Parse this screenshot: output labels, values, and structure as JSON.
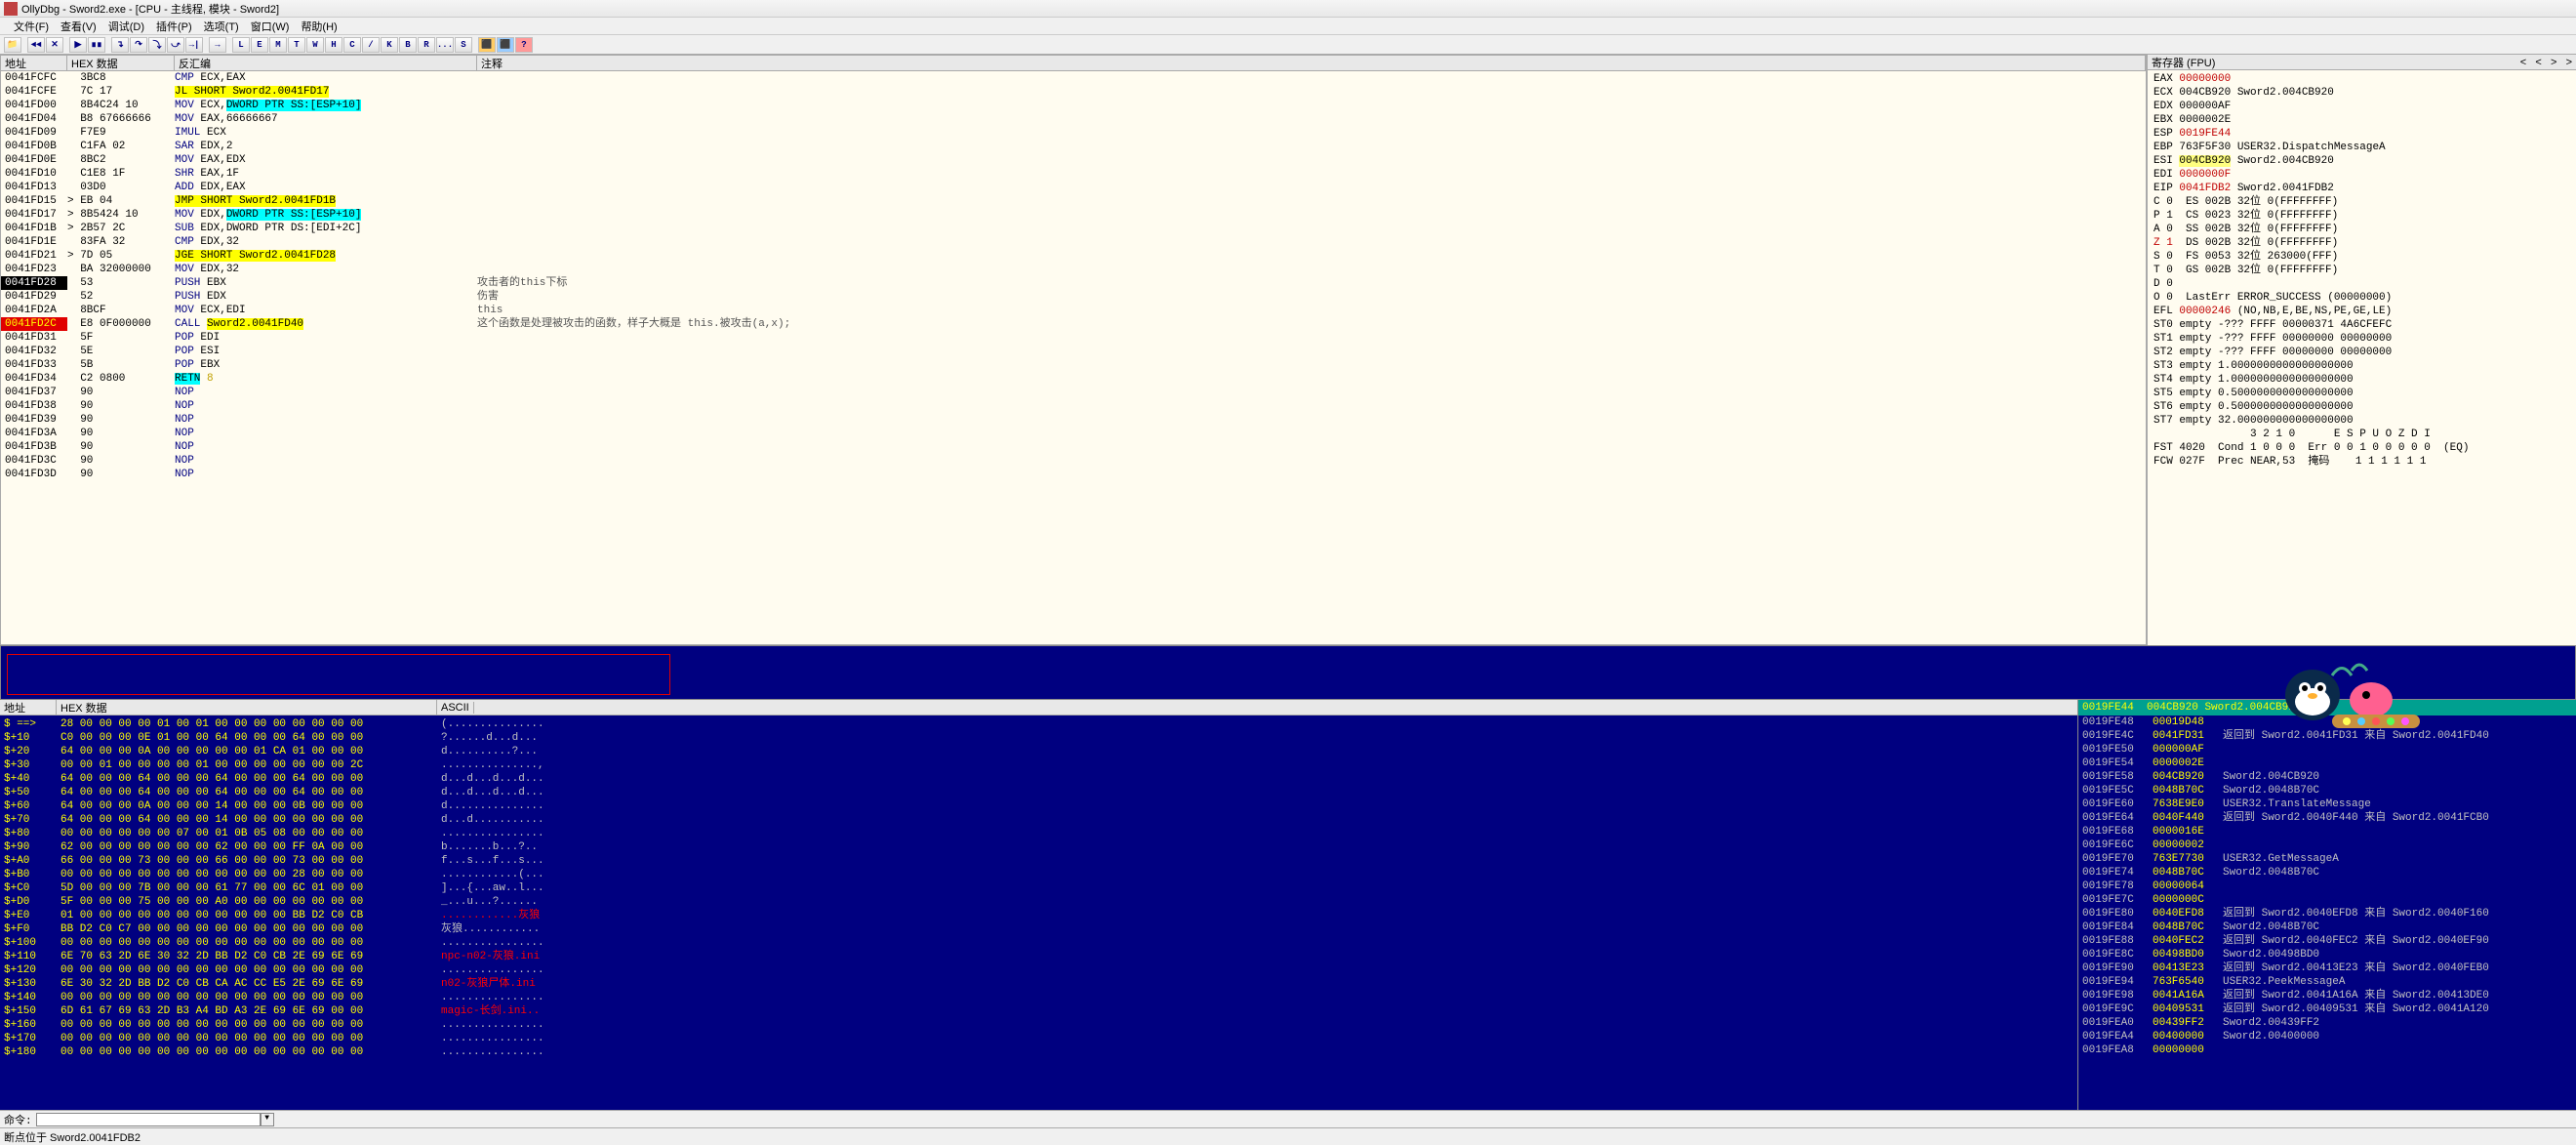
{
  "title": "OllyDbg - Sword2.exe - [CPU - 主线程, 模块 - Sword2]",
  "menu": [
    "文件(F)",
    "查看(V)",
    "调试(D)",
    "插件(P)",
    "选项(T)",
    "窗口(W)",
    "帮助(H)"
  ],
  "toolbar_letters": [
    "L",
    "E",
    "M",
    "T",
    "W",
    "H",
    "C",
    "/",
    "K",
    "B",
    "R",
    "...",
    "S"
  ],
  "disasm_headers": {
    "addr": "地址",
    "hex": "HEX 数据",
    "dis": "反汇编",
    "cmt": "注释"
  },
  "disasm": [
    {
      "a": "0041FCFC",
      "h": "3BC8",
      "d": [
        "CMP",
        "ECX,EAX"
      ],
      "c": ""
    },
    {
      "a": "0041FCFE",
      "h": "7C 17",
      "d": [
        "JL SHORT",
        "Sword2.0041FD17"
      ],
      "c": "",
      "jmp": true
    },
    {
      "a": "0041FD00",
      "h": "8B4C24 10",
      "d": [
        "MOV",
        "ECX,",
        "DWORD PTR SS:[ESP+10]"
      ],
      "c": "",
      "mem": true
    },
    {
      "a": "0041FD04",
      "h": "B8 67666666",
      "d": [
        "MOV",
        "EAX,",
        "66666667"
      ],
      "c": ""
    },
    {
      "a": "0041FD09",
      "h": "F7E9",
      "d": [
        "IMUL",
        "ECX"
      ],
      "c": ""
    },
    {
      "a": "0041FD0B",
      "h": "C1FA 02",
      "d": [
        "SAR",
        "EDX,",
        "2"
      ],
      "c": ""
    },
    {
      "a": "0041FD0E",
      "h": "8BC2",
      "d": [
        "MOV",
        "EAX,EDX"
      ],
      "c": ""
    },
    {
      "a": "0041FD10",
      "h": "C1E8 1F",
      "d": [
        "SHR",
        "EAX,",
        "1F"
      ],
      "c": ""
    },
    {
      "a": "0041FD13",
      "h": "03D0",
      "d": [
        "ADD",
        "EDX,EAX"
      ],
      "c": ""
    },
    {
      "a": "0041FD15",
      "h": "EB 04",
      "d": [
        "JMP SHORT",
        "Sword2.0041FD1B"
      ],
      "c": "",
      "jmp": true,
      "arrow": ">"
    },
    {
      "a": "0041FD17",
      "h": "8B5424 10",
      "d": [
        "MOV",
        "EDX,",
        "DWORD PTR SS:[ESP+10]"
      ],
      "c": "",
      "mem": true,
      "arrow": ">"
    },
    {
      "a": "0041FD1B",
      "h": "2B57 2C",
      "d": [
        "SUB",
        "EDX,",
        "DWORD PTR DS:[EDI+2C]"
      ],
      "c": "",
      "mem2": true,
      "arrow": ">"
    },
    {
      "a": "0041FD1E",
      "h": "83FA 32",
      "d": [
        "CMP",
        "EDX,",
        "32"
      ],
      "c": ""
    },
    {
      "a": "0041FD21",
      "h": "7D 05",
      "d": [
        "JGE SHORT",
        "Sword2.0041FD28"
      ],
      "c": "",
      "jmp": true,
      "arrow": ">"
    },
    {
      "a": "0041FD23",
      "h": "BA 32000000",
      "d": [
        "MOV",
        "EDX,",
        "32"
      ],
      "c": ""
    },
    {
      "a": "0041FD28",
      "h": "53",
      "d": [
        "PUSH",
        "EBX"
      ],
      "c": "攻击者的this下标",
      "sel": true
    },
    {
      "a": "0041FD29",
      "h": "52",
      "d": [
        "PUSH",
        "EDX"
      ],
      "c": "伤害"
    },
    {
      "a": "0041FD2A",
      "h": "8BCF",
      "d": [
        "MOV",
        "ECX,EDI"
      ],
      "c": "this"
    },
    {
      "a": "0041FD2C",
      "h": "E8 0F000000",
      "d": [
        "CALL",
        "Sword2.0041FD40"
      ],
      "c": "这个函数是处理被攻击的函数，样子大概是 this.被攻击(a,x);",
      "call": true,
      "redaddr": true
    },
    {
      "a": "0041FD31",
      "h": "5F",
      "d": [
        "POP",
        "EDI"
      ],
      "c": ""
    },
    {
      "a": "0041FD32",
      "h": "5E",
      "d": [
        "POP",
        "ESI"
      ],
      "c": ""
    },
    {
      "a": "0041FD33",
      "h": "5B",
      "d": [
        "POP",
        "EBX"
      ],
      "c": ""
    },
    {
      "a": "0041FD34",
      "h": "C2 0800",
      "d": [
        "RETN",
        "8"
      ],
      "c": "",
      "retn": true
    },
    {
      "a": "0041FD37",
      "h": "90",
      "d": [
        "NOP",
        ""
      ],
      "c": ""
    },
    {
      "a": "0041FD38",
      "h": "90",
      "d": [
        "NOP",
        ""
      ],
      "c": ""
    },
    {
      "a": "0041FD39",
      "h": "90",
      "d": [
        "NOP",
        ""
      ],
      "c": ""
    },
    {
      "a": "0041FD3A",
      "h": "90",
      "d": [
        "NOP",
        ""
      ],
      "c": ""
    },
    {
      "a": "0041FD3B",
      "h": "90",
      "d": [
        "NOP",
        ""
      ],
      "c": ""
    },
    {
      "a": "0041FD3C",
      "h": "90",
      "d": [
        "NOP",
        ""
      ],
      "c": ""
    },
    {
      "a": "0041FD3D",
      "h": "90",
      "d": [
        "NOP",
        ""
      ],
      "c": ""
    }
  ],
  "registers": {
    "header": "寄存器 (FPU)",
    "lines": [
      {
        "t": "EAX ",
        "v": "00000000",
        "red": true
      },
      {
        "t": "ECX ",
        "v": "004CB920",
        "s": " Sword2.004CB920"
      },
      {
        "t": "EDX ",
        "v": "000000AF"
      },
      {
        "t": "EBX ",
        "v": "0000002E"
      },
      {
        "t": "ESP ",
        "v": "0019FE44",
        "red": true
      },
      {
        "t": "EBP ",
        "v": "763F5F30",
        "s": " USER32.DispatchMessageA"
      },
      {
        "t": "ESI ",
        "v": "004CB920",
        "s": " Sword2.004CB920",
        "hl": true
      },
      {
        "t": "EDI ",
        "v": "0000000F",
        "red": true
      },
      {
        "t": "",
        "v": ""
      },
      {
        "t": "EIP ",
        "v": "0041FDB2",
        "s": " Sword2.0041FDB2",
        "red2": true
      },
      {
        "t": "",
        "v": ""
      },
      {
        "t": "C 0  ES 002B 32位 0(FFFFFFFF)"
      },
      {
        "t": "P 1  CS 0023 32位 0(FFFFFFFF)"
      },
      {
        "t": "A 0  SS 002B 32位 0(FFFFFFFF)"
      },
      {
        "t": "Z 1  DS 002B 32位 0(FFFFFFFF)",
        "zred": true
      },
      {
        "t": "S 0  FS 0053 32位 263000(FFF)"
      },
      {
        "t": "T 0  GS 002B 32位 0(FFFFFFFF)"
      },
      {
        "t": "D 0"
      },
      {
        "t": "O 0  LastErr ERROR_SUCCESS (00000000)"
      },
      {
        "t": "",
        "v": ""
      },
      {
        "t": "EFL ",
        "v": "00000246",
        "s": " (NO,NB,E,BE,NS,PE,GE,LE)",
        "red": true
      },
      {
        "t": "",
        "v": ""
      },
      {
        "t": "ST0 empty -??? FFFF 00000371 4A6CFEFC"
      },
      {
        "t": "ST1 empty -??? FFFF 00000000 00000000"
      },
      {
        "t": "ST2 empty -??? FFFF 00000000 00000000"
      },
      {
        "t": "ST3 empty 1.0000000000000000000"
      },
      {
        "t": "ST4 empty 1.0000000000000000000"
      },
      {
        "t": "ST5 empty 0.5000000000000000000"
      },
      {
        "t": "ST6 empty 0.5000000000000000000"
      },
      {
        "t": "ST7 empty 32.000000000000000000"
      },
      {
        "t": "               3 2 1 0      E S P U O Z D I"
      },
      {
        "t": "FST 4020  Cond 1 0 0 0  Err 0 0 1 0 0 0 0 0  (EQ)"
      },
      {
        "t": "FCW 027F  Prec NEAR,53  掩码    1 1 1 1 1 1"
      }
    ]
  },
  "hex_headers": {
    "addr": "地址",
    "hex": "HEX 数据",
    "ascii": "ASCII"
  },
  "hex_rows": [
    {
      "a": "$ ==>",
      "b": "28 00 00 00 00 01 00 01 00 00 00 00 00 00 00 00",
      "t": "(..............."
    },
    {
      "a": "$+10",
      "b": "C0 00 00 00 0E 01 00 00 64 00 00 00 64 00 00 00",
      "t": "?......d...d..."
    },
    {
      "a": "$+20",
      "b": "64 00 00 00 0A 00 00 00 00 00 01 CA 01 00 00 00",
      "t": "d..........?..."
    },
    {
      "a": "$+30",
      "b": "00 00 01 00 00 00 00 01 00 00 00 00 00 00 00 2C",
      "t": "...............,",
      "hlt": true
    },
    {
      "a": "$+40",
      "b": "64 00 00 00 64 00 00 00 64 00 00 00 64 00 00 00",
      "t": "d...d...d...d..."
    },
    {
      "a": "$+50",
      "b": "64 00 00 00 64 00 00 00 64 00 00 00 64 00 00 00",
      "t": "d...d...d...d..."
    },
    {
      "a": "$+60",
      "b": "64 00 00 00 0A 00 00 00 14 00 00 00 0B 00 00 00",
      "t": "d..............."
    },
    {
      "a": "$+70",
      "b": "64 00 00 00 64 00 00 00 14 00 00 00 00 00 00 00",
      "t": "d...d..........."
    },
    {
      "a": "$+80",
      "b": "00 00 00 00 00 00 07 00 01 0B 05 08 00 00 00 00",
      "t": "................"
    },
    {
      "a": "$+90",
      "b": "62 00 00 00 00 00 00 00 62 00 00 00 FF 0A 00 00",
      "t": "b.......b...?..",
      "hlt2": true
    },
    {
      "a": "$+A0",
      "b": "66 00 00 00 73 00 00 00 66 00 00 00 73 00 00 00",
      "t": "f...s...f...s..."
    },
    {
      "a": "$+B0",
      "b": "00 00 00 00 00 00 00 00 00 00 00 00 28 00 00 00",
      "t": "............(..."
    },
    {
      "a": "$+C0",
      "b": "5D 00 00 00 7B 00 00 00 61 77 00 00 6C 01 00 00",
      "t": "]...{...aw..l...",
      "hl": true
    },
    {
      "a": "$+D0",
      "b": "5F 00 00 00 75 00 00 00 A0 00 00 00 00 00 00 00",
      "t": "_...u...?......",
      "hl": true
    },
    {
      "a": "$+E0",
      "b": "01 00 00 00 00 00 00 00 00 00 00 00 BB D2 C0 CB",
      "t": "............灰狼",
      "hl": true,
      "cn": "灰狼"
    },
    {
      "a": "$+F0",
      "b": "BB D2 C0 C7 00 00 00 00 00 00 00 00 00 00 00 00",
      "t": "灰狼............"
    },
    {
      "a": "$+100",
      "b": "00 00 00 00 00 00 00 00 00 00 00 00 00 00 00 00",
      "t": "................"
    },
    {
      "a": "$+110",
      "b": "6E 70 63 2D 6E 30 32 2D BB D2 C0 CB 2E 69 6E 69",
      "t": "npc-n02-灰狼.ini",
      "cn": true
    },
    {
      "a": "$+120",
      "b": "00 00 00 00 00 00 00 00 00 00 00 00 00 00 00 00",
      "t": "................"
    },
    {
      "a": "$+130",
      "b": "6E 30 32 2D BB D2 C0 CB CA AC CC E5 2E 69 6E 69",
      "t": "n02-灰狼尸体.ini",
      "cn": true
    },
    {
      "a": "$+140",
      "b": "00 00 00 00 00 00 00 00 00 00 00 00 00 00 00 00",
      "t": "................"
    },
    {
      "a": "$+150",
      "b": "6D 61 67 69 63 2D B3 A4 BD A3 2E 69 6E 69 00 00",
      "t": "magic-长剑.ini..",
      "cn": true
    },
    {
      "a": "$+160",
      "b": "00 00 00 00 00 00 00 00 00 00 00 00 00 00 00 00",
      "t": "................"
    },
    {
      "a": "$+170",
      "b": "00 00 00 00 00 00 00 00 00 00 00 00 00 00 00 00",
      "t": "................"
    },
    {
      "a": "$+180",
      "b": "00 00 00 00 00 00 00 00 00 00 00 00 00 00 00 00",
      "t": "................"
    }
  ],
  "stack_header": {
    "a": "0019FE44",
    "v": "004CB920",
    "c": "Sword2.004CB920"
  },
  "stack": [
    {
      "a": "0019FE48",
      "v": "00019D48",
      "c": ""
    },
    {
      "a": "0019FE4C",
      "v": "0041FD31",
      "c": "返回到 Sword2.0041FD31 来自 Sword2.0041FD40",
      "ret": true
    },
    {
      "a": "0019FE50",
      "v": "000000AF",
      "c": ""
    },
    {
      "a": "0019FE54",
      "v": "0000002E",
      "c": ""
    },
    {
      "a": "0019FE58",
      "v": "004CB920",
      "c": "Sword2.004CB920"
    },
    {
      "a": "0019FE5C",
      "v": "0048B70C",
      "c": "Sword2.0048B70C"
    },
    {
      "a": "0019FE60",
      "v": "7638E9E0",
      "c": "USER32.TranslateMessage"
    },
    {
      "a": "0019FE64",
      "v": "0040F440",
      "c": "返回到 Sword2.0040F440 来自 Sword2.0041FCB0",
      "ret": true
    },
    {
      "a": "0019FE68",
      "v": "0000016E",
      "c": ""
    },
    {
      "a": "0019FE6C",
      "v": "00000002",
      "c": ""
    },
    {
      "a": "0019FE70",
      "v": "763E7730",
      "c": "USER32.GetMessageA"
    },
    {
      "a": "0019FE74",
      "v": "0048B70C",
      "c": "Sword2.0048B70C"
    },
    {
      "a": "0019FE78",
      "v": "00000064",
      "c": ""
    },
    {
      "a": "0019FE7C",
      "v": "0000000C",
      "c": ""
    },
    {
      "a": "0019FE80",
      "v": "0040EFD8",
      "c": "返回到 Sword2.0040EFD8 来自 Sword2.0040F160",
      "ret": true
    },
    {
      "a": "0019FE84",
      "v": "0048B70C",
      "c": "Sword2.0048B70C"
    },
    {
      "a": "0019FE88",
      "v": "0040FEC2",
      "c": "返回到 Sword2.0040FEC2 来自 Sword2.0040EF90",
      "ret": true
    },
    {
      "a": "0019FE8C",
      "v": "00498BD0",
      "c": "Sword2.00498BD0"
    },
    {
      "a": "0019FE90",
      "v": "00413E23",
      "c": "返回到 Sword2.00413E23 来自 Sword2.0040FEB0",
      "ret": true
    },
    {
      "a": "0019FE94",
      "v": "763F6540",
      "c": "USER32.PeekMessageA"
    },
    {
      "a": "0019FE98",
      "v": "0041A16A",
      "c": "返回到 Sword2.0041A16A 来自 Sword2.00413DE0",
      "ret": true
    },
    {
      "a": "0019FE9C",
      "v": "00409531",
      "c": "返回到 Sword2.00409531 来自 Sword2.0041A120",
      "ret": true
    },
    {
      "a": "0019FEA0",
      "v": "00439FF2",
      "c": "Sword2.00439FF2"
    },
    {
      "a": "0019FEA4",
      "v": "00400000",
      "c": "Sword2.00400000"
    },
    {
      "a": "0019FEA8",
      "v": "00000000",
      "c": ""
    }
  ],
  "cmdbar_label": "命令:",
  "statusbar": "断点位于 Sword2.0041FDB2"
}
